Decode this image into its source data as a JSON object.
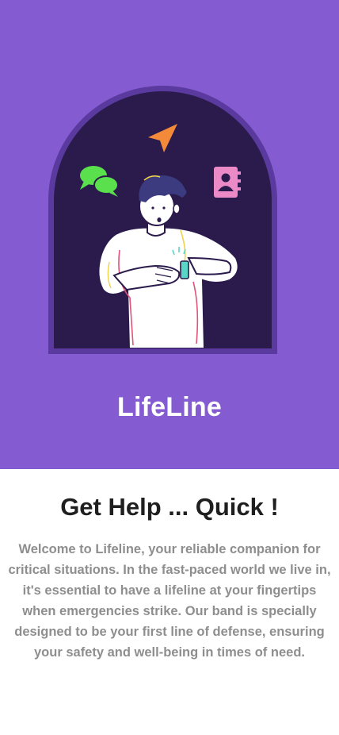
{
  "hero": {
    "app_name": "LifeLine",
    "background_color": "#845bd1",
    "icons": [
      "navigation-arrow-icon",
      "chat-bubbles-icon",
      "contacts-book-icon"
    ]
  },
  "content": {
    "headline": "Get Help ... Quick !",
    "description": "Welcome to Lifeline, your reliable companion for critical situations. In the fast-paced world we live in, it's essential to have a lifeline at your fingertips when emergencies strike. Our band is specially designed to be your first line of defense, ensuring your safety and well-being in times of need."
  }
}
